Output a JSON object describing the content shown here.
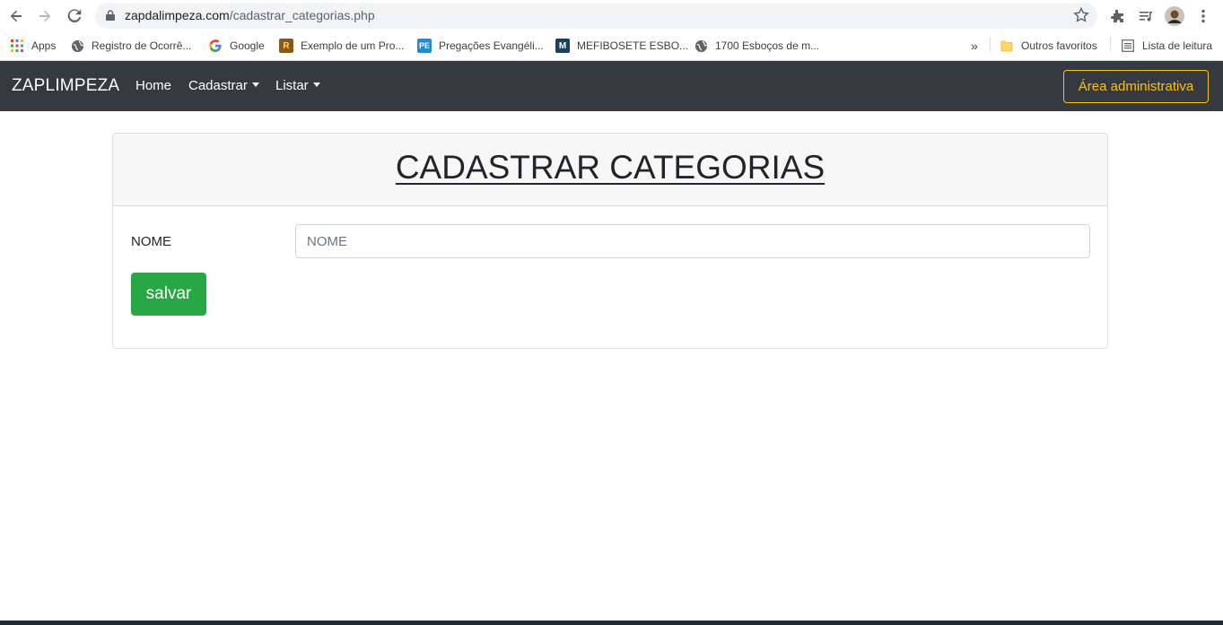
{
  "browser": {
    "url_host": "zapdalimpeza.com",
    "url_path": "/cadastrar_categorias.php",
    "icons": [
      "back-icon",
      "forward-icon",
      "reload-icon",
      "lock-icon",
      "star-icon",
      "extensions-icon",
      "media-icon",
      "profile-avatar",
      "menu-icon"
    ]
  },
  "bookmarks": {
    "items": [
      {
        "label": "Apps",
        "icon": "apps-grid-icon"
      },
      {
        "label": "Registro de Ocorrê...",
        "icon": "globe-icon"
      },
      {
        "label": "Google",
        "icon": "google-icon"
      },
      {
        "label": "Exemplo de um Pro...",
        "icon": "r-badge-icon",
        "glyph": "R"
      },
      {
        "label": "Pregações Evangéli...",
        "icon": "pe-badge-icon",
        "glyph": "PE"
      },
      {
        "label": "MEFIBOSETE ESBO...",
        "icon": "m-badge-icon",
        "glyph": "M"
      },
      {
        "label": "1700 Esboços de m...",
        "icon": "globe-icon"
      }
    ],
    "overflow": "»",
    "other_favorites": "Outros favoritos",
    "reading_list": "Lista de leitura"
  },
  "navbar": {
    "brand": "ZAPLIMPEZA",
    "links": [
      {
        "label": "Home",
        "dropdown": false
      },
      {
        "label": "Cadastrar",
        "dropdown": true
      },
      {
        "label": "Listar",
        "dropdown": true
      }
    ],
    "admin_button": "Área administrativa"
  },
  "form": {
    "title": "CADASTRAR CATEGORIAS",
    "name_label": "NOME",
    "name_value": "",
    "name_placeholder": "NOME",
    "save_label": "salvar"
  },
  "colors": {
    "navbar_bg": "#343a40",
    "admin_outline": "#ffc107",
    "save_bg": "#28a745"
  }
}
